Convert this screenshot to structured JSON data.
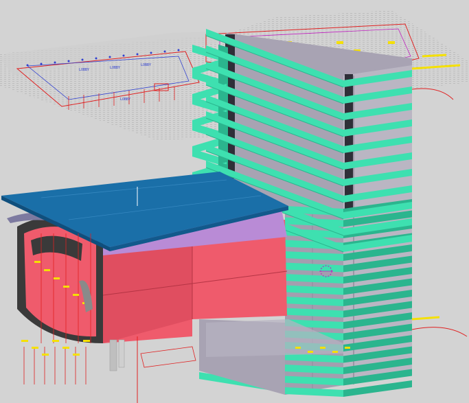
{
  "viewport": {
    "background": "#d3d3d3",
    "kind": "3D BIM model viewport"
  },
  "colors": {
    "floor_slab": "#3ee0b0",
    "floor_slab_dark": "#2bb58e",
    "tower_wall": "#a8a3b3",
    "tower_wall_light": "#bab6c3",
    "tower_wall_dark": "#908a9c",
    "core_dark": "#2f2f38",
    "tunnel_body": "#ef5b6c",
    "tunnel_body_dark": "#c8414f",
    "tunnel_lining": "#3a3a3a",
    "roof_slab": "#1a6fa8",
    "roof_slab_dark": "#0f4f7d",
    "roof_under": "#b98bd6",
    "cad_red": "#e02020",
    "cad_blue": "#3040d0",
    "cad_yellow": "#f5e000",
    "cad_magenta": "#c020c0"
  },
  "cad_labels": [
    "LOBBY",
    "LOBBY",
    "LOBBY",
    "LOBBY"
  ],
  "tower": {
    "floor_count": 17
  }
}
